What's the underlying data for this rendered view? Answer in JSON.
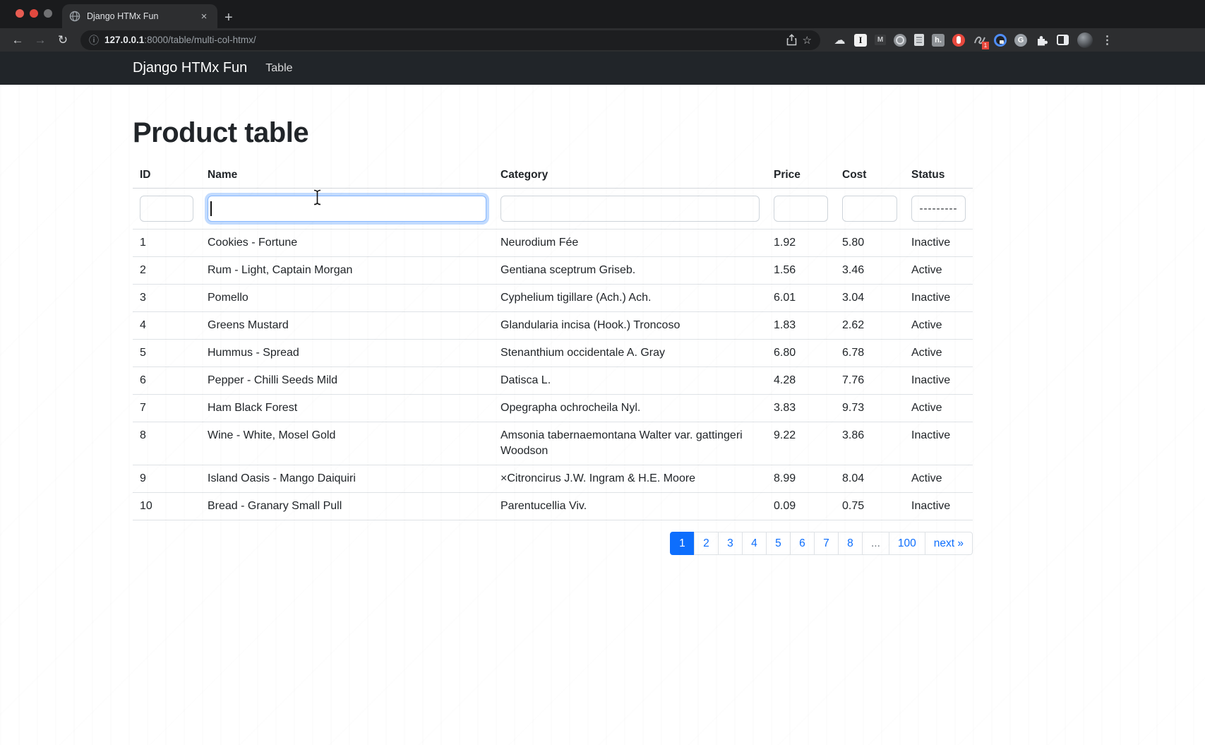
{
  "colors": {
    "accent": "#0d6efd",
    "navbar_bg": "#212529",
    "pagination_active_bg": "#0d6efd",
    "focus_ring_border": "#86b7fe",
    "table_border": "#dee2e6"
  },
  "browser": {
    "tab": {
      "title": "Django HTMx Fun",
      "close_glyph": "×",
      "new_tab_glyph": "+"
    },
    "nav_glyphs": {
      "back": "←",
      "forward": "→",
      "reload": "↻",
      "info": "ⓘ",
      "star": "☆",
      "cloud": "☁",
      "kebab": "⋮"
    },
    "url": {
      "host": "127.0.0.1",
      "rest": ":8000/table/multi-col-htmx/"
    },
    "extension_letters": {
      "instapaper": "I",
      "mail": "M",
      "h": "h.",
      "g": "G",
      "badge_count": "1"
    }
  },
  "navbar": {
    "brand": "Django HTMx Fun",
    "link_table": "Table"
  },
  "page": {
    "title": "Product table"
  },
  "table": {
    "columns": {
      "id": "ID",
      "name": "Name",
      "category": "Category",
      "price": "Price",
      "cost": "Cost",
      "status": "Status"
    },
    "filters": {
      "id_value": "",
      "name_value": "",
      "category_value": "",
      "price_value": "",
      "cost_value": "",
      "status_value": "---------"
    },
    "rows": [
      {
        "id": "1",
        "name": "Cookies - Fortune",
        "category": "Neurodium Fée",
        "price": "1.92",
        "cost": "5.80",
        "status": "Inactive"
      },
      {
        "id": "2",
        "name": "Rum - Light, Captain Morgan",
        "category": "Gentiana sceptrum Griseb.",
        "price": "1.56",
        "cost": "3.46",
        "status": "Active"
      },
      {
        "id": "3",
        "name": "Pomello",
        "category": "Cyphelium tigillare (Ach.) Ach.",
        "price": "6.01",
        "cost": "3.04",
        "status": "Inactive"
      },
      {
        "id": "4",
        "name": "Greens Mustard",
        "category": "Glandularia incisa (Hook.) Troncoso",
        "price": "1.83",
        "cost": "2.62",
        "status": "Active"
      },
      {
        "id": "5",
        "name": "Hummus - Spread",
        "category": "Stenanthium occidentale A. Gray",
        "price": "6.80",
        "cost": "6.78",
        "status": "Active"
      },
      {
        "id": "6",
        "name": "Pepper - Chilli Seeds Mild",
        "category": "Datisca L.",
        "price": "4.28",
        "cost": "7.76",
        "status": "Inactive"
      },
      {
        "id": "7",
        "name": "Ham Black Forest",
        "category": "Opegrapha ochrocheila Nyl.",
        "price": "3.83",
        "cost": "9.73",
        "status": "Active"
      },
      {
        "id": "8",
        "name": "Wine - White, Mosel Gold",
        "category": "Amsonia tabernaemontana Walter var. gattingeri Woodson",
        "price": "9.22",
        "cost": "3.86",
        "status": "Inactive"
      },
      {
        "id": "9",
        "name": "Island Oasis - Mango Daiquiri",
        "category": "×Citroncirus J.W. Ingram & H.E. Moore",
        "price": "8.99",
        "cost": "8.04",
        "status": "Active"
      },
      {
        "id": "10",
        "name": "Bread - Granary Small Pull",
        "category": "Parentucellia Viv.",
        "price": "0.09",
        "cost": "0.75",
        "status": "Inactive"
      }
    ]
  },
  "pagination": {
    "active_page": "1",
    "pages": [
      "1",
      "2",
      "3",
      "4",
      "5",
      "6",
      "7",
      "8",
      "...",
      "100"
    ],
    "next_label": "next »"
  }
}
